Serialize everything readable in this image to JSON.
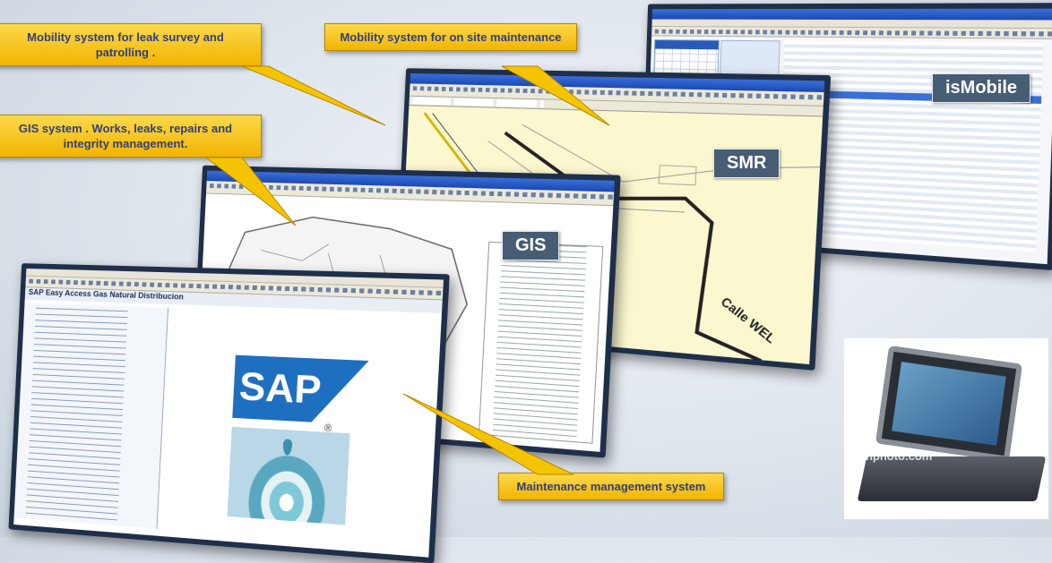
{
  "callouts": {
    "leak_survey": "Mobility system for leak survey and patrolling .",
    "onsite_maintenance": "Mobility system for on site maintenance",
    "gis_works": "GIS system . Works, leaks, repairs and integrity management.",
    "maintenance_mgmt": "Maintenance management system"
  },
  "screens": {
    "ismobile": {
      "tag": "isMobile"
    },
    "smr": {
      "tag": "SMR",
      "street_label": "Calle WEL"
    },
    "gis": {
      "tag": "GIS"
    },
    "sap": {
      "title": "SAP Easy Access  Gas Natural Distribucion",
      "logo_text": "SAP",
      "logo_mark": "®"
    }
  },
  "watermark": "bhphoto.com",
  "colors": {
    "callout_fill": "#f5c400",
    "callout_text": "#2f3f7a",
    "screen_frame": "#1f2f4a",
    "tag_fill": "#475d74",
    "sap_blue": "#1f6fc0"
  },
  "icons": [
    "tablet-laptop-icon",
    "water-drop-icon",
    "arrow-pointer-icon"
  ]
}
